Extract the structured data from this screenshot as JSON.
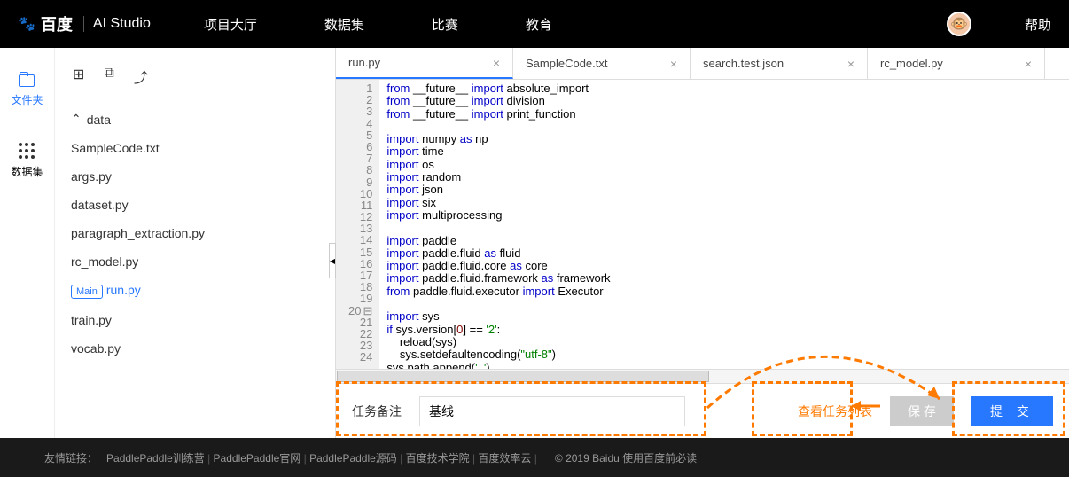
{
  "header": {
    "logo_baidu": "百度",
    "logo_studio": "AI Studio",
    "nav": [
      "项目大厅",
      "数据集",
      "比赛",
      "教育"
    ],
    "help": "帮助"
  },
  "rail": {
    "files": "文件夹",
    "datasets": "数据集"
  },
  "tree": {
    "folder": "data",
    "files": [
      "SampleCode.txt",
      "args.py",
      "dataset.py",
      "paragraph_extraction.py",
      "rc_model.py",
      "run.py",
      "train.py",
      "vocab.py"
    ],
    "main_badge": "Main",
    "active_file": "run.py"
  },
  "tabs": [
    {
      "label": "run.py",
      "active": true
    },
    {
      "label": "SampleCode.txt",
      "active": false
    },
    {
      "label": "search.test.json",
      "active": false
    },
    {
      "label": "rc_model.py",
      "active": false
    }
  ],
  "code_lines": [
    [
      {
        "t": "from ",
        "c": "kw"
      },
      {
        "t": "__future__ "
      },
      {
        "t": "import ",
        "c": "kw"
      },
      {
        "t": "absolute_import"
      }
    ],
    [
      {
        "t": "from ",
        "c": "kw"
      },
      {
        "t": "__future__ "
      },
      {
        "t": "import ",
        "c": "kw"
      },
      {
        "t": "division"
      }
    ],
    [
      {
        "t": "from ",
        "c": "kw"
      },
      {
        "t": "__future__ "
      },
      {
        "t": "import ",
        "c": "kw"
      },
      {
        "t": "print_function"
      }
    ],
    [],
    [
      {
        "t": "import ",
        "c": "kw"
      },
      {
        "t": "numpy "
      },
      {
        "t": "as ",
        "c": "kw"
      },
      {
        "t": "np"
      }
    ],
    [
      {
        "t": "import ",
        "c": "kw"
      },
      {
        "t": "time"
      }
    ],
    [
      {
        "t": "import ",
        "c": "kw"
      },
      {
        "t": "os"
      }
    ],
    [
      {
        "t": "import ",
        "c": "kw"
      },
      {
        "t": "random"
      }
    ],
    [
      {
        "t": "import ",
        "c": "kw"
      },
      {
        "t": "json"
      }
    ],
    [
      {
        "t": "import ",
        "c": "kw"
      },
      {
        "t": "six"
      }
    ],
    [
      {
        "t": "import ",
        "c": "kw"
      },
      {
        "t": "multiprocessing"
      }
    ],
    [],
    [
      {
        "t": "import ",
        "c": "kw"
      },
      {
        "t": "paddle"
      }
    ],
    [
      {
        "t": "import ",
        "c": "kw"
      },
      {
        "t": "paddle.fluid "
      },
      {
        "t": "as ",
        "c": "kw"
      },
      {
        "t": "fluid"
      }
    ],
    [
      {
        "t": "import ",
        "c": "kw"
      },
      {
        "t": "paddle.fluid.core "
      },
      {
        "t": "as ",
        "c": "kw"
      },
      {
        "t": "core"
      }
    ],
    [
      {
        "t": "import ",
        "c": "kw"
      },
      {
        "t": "paddle.fluid.framework "
      },
      {
        "t": "as ",
        "c": "kw"
      },
      {
        "t": "framework"
      }
    ],
    [
      {
        "t": "from ",
        "c": "kw"
      },
      {
        "t": "paddle.fluid.executor "
      },
      {
        "t": "import ",
        "c": "kw"
      },
      {
        "t": "Executor"
      }
    ],
    [],
    [
      {
        "t": "import ",
        "c": "kw"
      },
      {
        "t": "sys"
      }
    ],
    [
      {
        "t": "if ",
        "c": "kw"
      },
      {
        "t": "sys.version["
      },
      {
        "t": "0",
        "c": "num"
      },
      {
        "t": "] == "
      },
      {
        "t": "'2'",
        "c": "str"
      },
      {
        "t": ":"
      }
    ],
    [
      {
        "t": "    reload(sys)"
      }
    ],
    [
      {
        "t": "    sys.setdefaultencoding("
      },
      {
        "t": "\"utf-8\"",
        "c": "str"
      },
      {
        "t": ")"
      }
    ],
    [
      {
        "t": "sys.path.append("
      },
      {
        "t": "'..'",
        "c": "str"
      },
      {
        "t": ")"
      }
    ],
    []
  ],
  "footer": {
    "note_label": "任务备注",
    "note_value": "基线",
    "view_tasks": "查看任务列表",
    "save": "保 存",
    "submit": "提 交"
  },
  "links": {
    "prefix": "友情链接：",
    "items": [
      "PaddlePaddle训练营",
      "PaddlePaddle官网",
      "PaddlePaddle源码",
      "百度技术学院",
      "百度效率云"
    ],
    "copyright": "© 2019 Baidu 使用百度前必读"
  }
}
